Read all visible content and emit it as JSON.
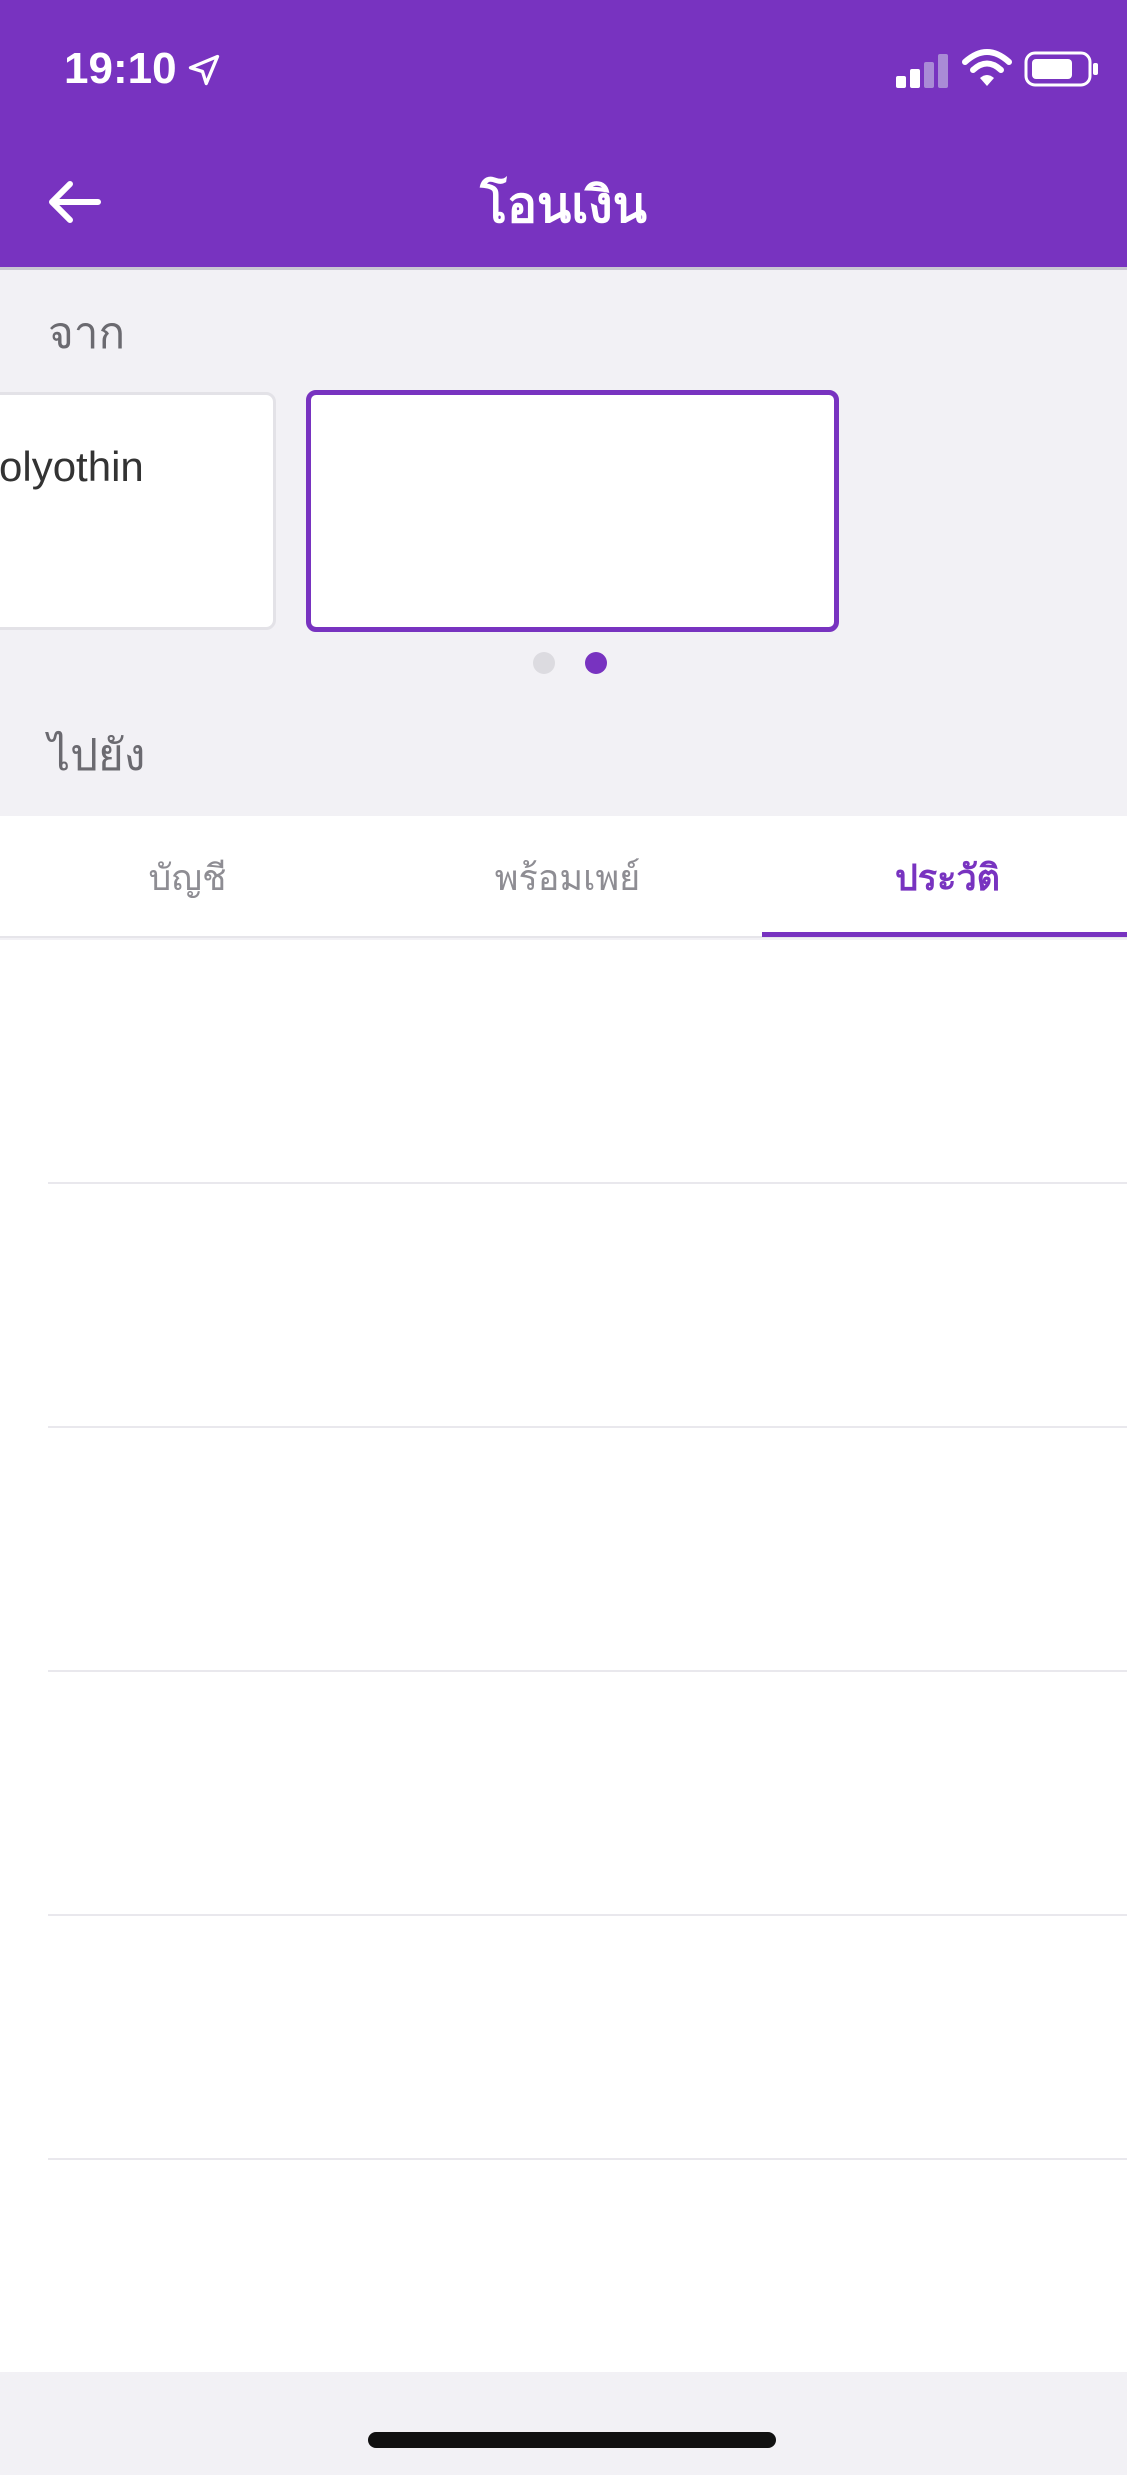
{
  "status_bar": {
    "time": "19:10",
    "icons": [
      "location-arrow-icon",
      "cellular-signal-icon",
      "wifi-icon",
      "battery-icon"
    ]
  },
  "header": {
    "title": "โอนเงิน",
    "back_icon": "arrow-left-icon",
    "background_color": "#7833c0"
  },
  "from_section": {
    "label": "จาก",
    "cards": [
      {
        "text": "olyothin"
      },
      {
        "text": ""
      }
    ],
    "page_count": 2,
    "active_page": 2
  },
  "to_section": {
    "label": "ไปยัง"
  },
  "tabs": [
    {
      "label": "บัญชี",
      "active": false
    },
    {
      "label": "พร้อมเพย์",
      "active": false
    },
    {
      "label": "ประวัติ",
      "active": true
    }
  ],
  "history_rows": [
    {},
    {},
    {},
    {},
    {}
  ],
  "colors": {
    "accent": "#7833c0",
    "page_background": "#f2f1f5",
    "inactive_text": "#8e8d93"
  }
}
